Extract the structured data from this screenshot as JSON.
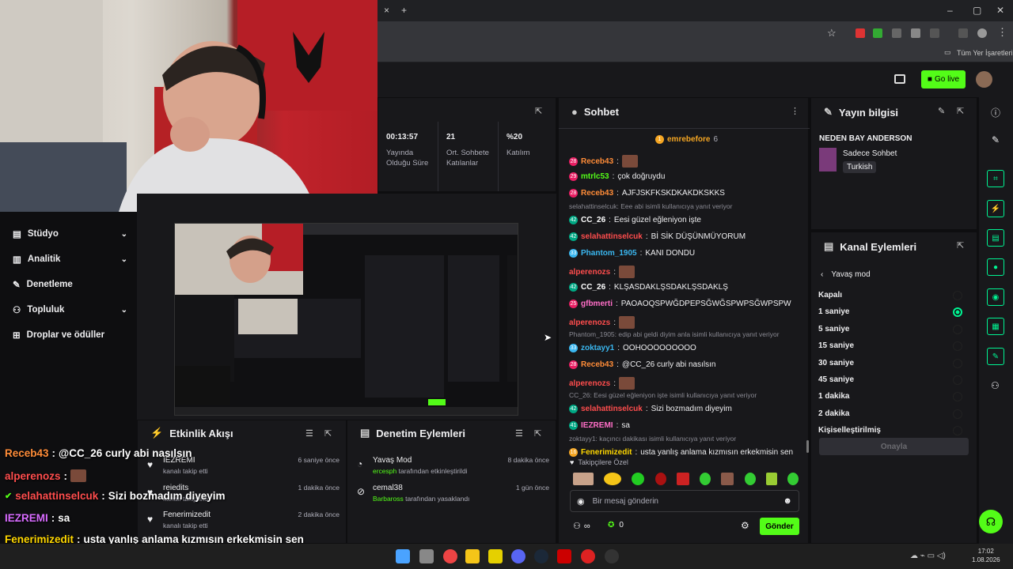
{
  "browser": {
    "close_tab": "×",
    "new_tab": "+",
    "bookmarks_label": "Tüm Yer İşaretleri",
    "win_min": "–",
    "win_max": "▢",
    "win_close": "✕"
  },
  "header": {
    "go_live": "Go live"
  },
  "sidebar": {
    "items": [
      {
        "label": "Stüdyo",
        "chev": "⌄"
      },
      {
        "label": "Analitik",
        "chev": "⌄"
      },
      {
        "label": "Denetleme",
        "chev": ""
      },
      {
        "label": "Topluluk",
        "chev": "⌄"
      },
      {
        "label": "Droplar ve ödüller",
        "chev": ""
      }
    ]
  },
  "stats": [
    {
      "value": "00:13:57",
      "label": "Yayında Olduğu Süre"
    },
    {
      "value": "21",
      "label": "Ort. Sohbete Katılanlar"
    },
    {
      "value": "%20",
      "label": "Katılım"
    }
  ],
  "chat": {
    "title": "Sohbet",
    "pinned_user": "emrebefore",
    "pinned_count": "6",
    "messages": [
      {
        "badge": "28",
        "badge_color": "#e91e63",
        "user": "Receb43",
        "user_color": "#ff8c38",
        "text": "",
        "emote": true,
        "reply": ""
      },
      {
        "badge": "29",
        "badge_color": "#e91e63",
        "user": "mtrlc53",
        "user_color": "#53fc18",
        "text": "çok doğruydu",
        "emote": false,
        "reply": ""
      },
      {
        "badge": "28",
        "badge_color": "#e91e63",
        "user": "Receb43",
        "user_color": "#ff8c38",
        "text": "AJFJSKFKSKDKAKDKSKKS",
        "emote": false,
        "reply": ""
      },
      {
        "badge": "42",
        "badge_color": "#00a884",
        "user": "CC_26",
        "user_color": "#ffffff",
        "text": "Eesi güzel eğleniyon işte",
        "emote": false,
        "reply": "selahattinselcuk: Eee abi isimli kullanıcıya yanıt veriyor"
      },
      {
        "badge": "42",
        "badge_color": "#00a884",
        "user": "selahattinselcuk",
        "user_color": "#ff4d4d",
        "text": "Bİ SİK DÜŞÜNMÜYORUM",
        "emote": false,
        "reply": ""
      },
      {
        "badge": "33",
        "badge_color": "#3ab7f0",
        "user": "Phantom_1905",
        "user_color": "#3ab7f0",
        "text": "KANI DONDU",
        "emote": false,
        "reply": ""
      },
      {
        "badge": "",
        "badge_color": "",
        "user": "alperenozs",
        "user_color": "#ff4d4d",
        "text": "",
        "emote": true,
        "reply": ""
      },
      {
        "badge": "42",
        "badge_color": "#00a884",
        "user": "CC_26",
        "user_color": "#ffffff",
        "text": "KLŞASDAKLŞSDAKLŞSDAKLŞ",
        "emote": false,
        "reply": ""
      },
      {
        "badge": "25",
        "badge_color": "#e91e63",
        "user": "gfbmerti",
        "user_color": "#ff6ec7",
        "text": "PAOAOQSPWĞDPEPSĞWĞSPWPSĞWPSPW",
        "emote": false,
        "reply": ""
      },
      {
        "badge": "",
        "badge_color": "",
        "user": "alperenozs",
        "user_color": "#ff4d4d",
        "text": "",
        "emote": true,
        "reply": ""
      },
      {
        "badge": "33",
        "badge_color": "#3ab7f0",
        "user": "zoktayy1",
        "user_color": "#3ab7f0",
        "text": "OOHOOOOOOOOO",
        "emote": false,
        "reply": "Phantom_1905: edip abi geldi diyim anla isimli kullanıcıya yanıt veriyor"
      },
      {
        "badge": "28",
        "badge_color": "#e91e63",
        "user": "Receb43",
        "user_color": "#ff8c38",
        "text": "@CC_26 curly abi nasılsın",
        "emote": false,
        "reply": ""
      },
      {
        "badge": "",
        "badge_color": "",
        "user": "alperenozs",
        "user_color": "#ff4d4d",
        "text": "",
        "emote": true,
        "reply": ""
      },
      {
        "badge": "42",
        "badge_color": "#00a884",
        "user": "selahattinselcuk",
        "user_color": "#ff4d4d",
        "text": "Sizi bozmadım diyeyim",
        "emote": false,
        "reply": "CC_26: Eesi güzel eğleniyon işte isimli kullanıcıya yanıt veriyor"
      },
      {
        "badge": "41",
        "badge_color": "#00a884",
        "user": "IEZREMI",
        "user_color": "#ff6ec7",
        "text": "sa",
        "emote": false,
        "reply": ""
      },
      {
        "badge": "16",
        "badge_color": "#f5a623",
        "user": "Fenerimizedit",
        "user_color": "#ffd700",
        "text": "usta yanlış anlama kızmısın erkekmisin sen",
        "emote": false,
        "reply": "zoktayy1: kaçıncı dakikası isimli kullanıcıya yanıt veriyor"
      }
    ],
    "followers_label": "Takipçilere Özel",
    "input_placeholder": "Bir mesaj gönderin",
    "infinity": "∞",
    "points": "0",
    "send": "Gönder"
  },
  "stream_info": {
    "title": "Yayın bilgisi",
    "stream_title": "NEDEN BAY ANDERSON",
    "category": "Sadece Sohbet",
    "tag": "Turkish"
  },
  "channel_actions": {
    "title": "Kanal Eylemleri",
    "sub": "Yavaş mod",
    "options": [
      {
        "label": "Kapalı",
        "on": false
      },
      {
        "label": "1 saniye",
        "on": true
      },
      {
        "label": "5 saniye",
        "on": false
      },
      {
        "label": "15 saniye",
        "on": false
      },
      {
        "label": "30 saniye",
        "on": false
      },
      {
        "label": "45 saniye",
        "on": false
      },
      {
        "label": "1 dakika",
        "on": false
      },
      {
        "label": "2 dakika",
        "on": false
      },
      {
        "label": "Kişiselleştirilmiş",
        "on": false
      }
    ],
    "confirm": "Onayla"
  },
  "activity": {
    "title": "Etkinlik Akışı",
    "items": [
      {
        "name": "IEZREMI",
        "sub": "kanalı takip etti",
        "time": "6 saniye önce"
      },
      {
        "name": "reiedits",
        "sub": "kanalı takip etti",
        "time": "1 dakika önce"
      },
      {
        "name": "Fenerimizedit",
        "sub": "kanalı takip etti",
        "time": "2 dakika önce"
      }
    ]
  },
  "moderation": {
    "title": "Denetim Eylemleri",
    "items": [
      {
        "name": "Yavaş Mod",
        "actor": "ercesph",
        "sub": "tarafından etkinleştirildi",
        "time": "8 dakika önce"
      },
      {
        "name": "cemal38",
        "actor": "Barbaross",
        "sub": "tarafından yasaklandı",
        "time": "1 gün önce"
      }
    ]
  },
  "overlay_chat": [
    {
      "user": "Receb43",
      "user_color": "#ff8c38",
      "text": "@CC_26 curly abi nasılsın",
      "emote": false,
      "check": false
    },
    {
      "user": "alperenozs",
      "user_color": "#ff4d4d",
      "text": "",
      "emote": true,
      "check": false
    },
    {
      "user": "selahattinselcuk",
      "user_color": "#ff4d4d",
      "text": "Sizi bozmadım diyeyim",
      "emote": false,
      "check": true
    },
    {
      "user": "IEZREMI",
      "user_color": "#d86bff",
      "text": "sa",
      "emote": false,
      "check": false
    },
    {
      "user": "Fenerimizedit",
      "user_color": "#ffd700",
      "text": "usta yanlış anlama kızmısın erkekmisin sen",
      "emote": false,
      "check": false
    }
  ],
  "taskbar": {
    "time": "17:02",
    "date": "1.08.2026"
  },
  "colors": {
    "accent": "#53fc18",
    "panel": "#18181b",
    "bg": "#0e0e10"
  }
}
